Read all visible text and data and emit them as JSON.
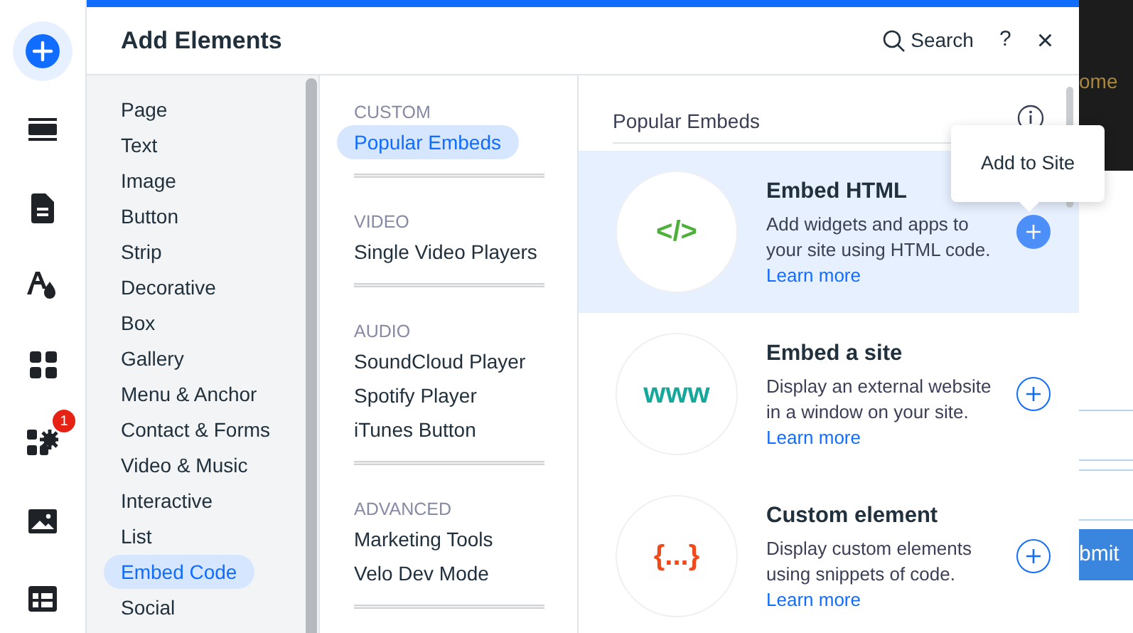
{
  "rail": [
    {
      "kind": "add",
      "selected": true
    },
    {
      "kind": "sections",
      "selected": false
    },
    {
      "kind": "pages",
      "selected": false
    },
    {
      "kind": "design",
      "selected": false
    },
    {
      "kind": "apps",
      "selected": false
    },
    {
      "kind": "business",
      "selected": false,
      "badge": "1"
    },
    {
      "kind": "media",
      "selected": false
    },
    {
      "kind": "cms",
      "selected": false
    }
  ],
  "panel": {
    "title": "Add Elements",
    "search": "Search",
    "help": "?",
    "close": "×"
  },
  "categories": [
    {
      "label": "Page",
      "selected": false
    },
    {
      "label": "Text",
      "selected": false
    },
    {
      "label": "Image",
      "selected": false
    },
    {
      "label": "Button",
      "selected": false
    },
    {
      "label": "Strip",
      "selected": false
    },
    {
      "label": "Decorative",
      "selected": false
    },
    {
      "label": "Box",
      "selected": false
    },
    {
      "label": "Gallery",
      "selected": false
    },
    {
      "label": "Menu & Anchor",
      "selected": false
    },
    {
      "label": "Contact & Forms",
      "selected": false
    },
    {
      "label": "Video & Music",
      "selected": false
    },
    {
      "label": "Interactive",
      "selected": false
    },
    {
      "label": "List",
      "selected": false
    },
    {
      "label": "Embed Code",
      "selected": true
    },
    {
      "label": "Social",
      "selected": false
    }
  ],
  "groups": [
    {
      "heading": "CUSTOM",
      "items": [
        {
          "label": "Popular Embeds",
          "selected": true
        }
      ]
    },
    {
      "heading": "VIDEO",
      "items": [
        {
          "label": "Single Video Players",
          "selected": false
        }
      ]
    },
    {
      "heading": "AUDIO",
      "items": [
        {
          "label": "SoundCloud Player",
          "selected": false
        },
        {
          "label": "Spotify Player",
          "selected": false
        },
        {
          "label": "iTunes Button",
          "selected": false
        }
      ]
    },
    {
      "heading": "ADVANCED",
      "items": [
        {
          "label": "Marketing Tools",
          "selected": false
        },
        {
          "label": "Velo Dev Mode",
          "selected": false
        }
      ]
    }
  ],
  "content": {
    "heading": "Popular Embeds",
    "cards": [
      {
        "title": "Embed HTML",
        "description": "Add widgets and apps to your site using HTML code.",
        "link": "Learn more",
        "glyph": "</>",
        "color": "#4eb03b",
        "selected": true
      },
      {
        "title": "Embed a site",
        "description": "Display an external website in a window on your site.",
        "link": "Learn more",
        "glyph": "www",
        "color": "#17a89c",
        "selected": false
      },
      {
        "title": "Custom element",
        "description": "Display custom elements using snippets of code.",
        "link": "Learn more",
        "glyph": "{...}",
        "color": "#ee4a1c",
        "selected": false
      }
    ],
    "tooltip": "Add to Site"
  },
  "background": {
    "text": "ome",
    "button": "bmit"
  }
}
